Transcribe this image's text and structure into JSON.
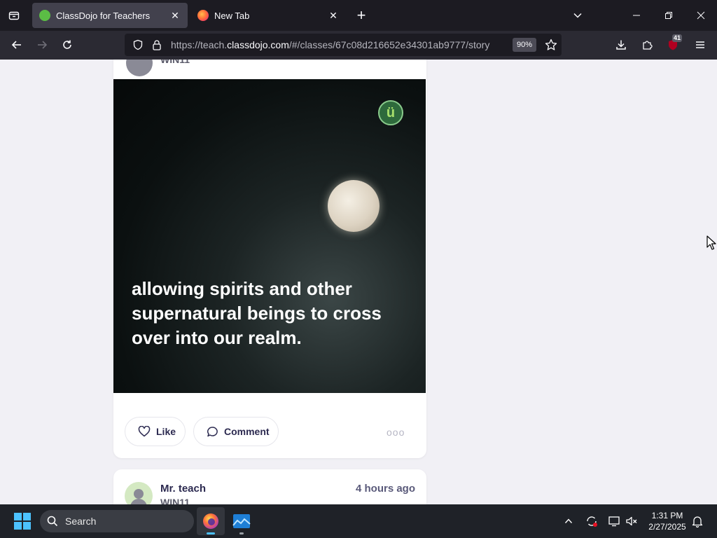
{
  "browser": {
    "tabs": [
      {
        "title": "ClassDojo for Teachers",
        "active": true
      },
      {
        "title": "New Tab",
        "active": false
      }
    ],
    "url_prefix": "https://teach.",
    "url_host": "classdojo.com",
    "url_path": "/#/classes/67c08d216652e34301ab9777/story",
    "zoom": "90%",
    "extension_badge": "41"
  },
  "feed": {
    "partial_post": {
      "class_name": "WIN11",
      "caption": "allowing spirits and other supernatural beings to cross over into our realm.",
      "like_label": "Like",
      "comment_label": "Comment",
      "more_label": "ooo",
      "badge_glyph": "ü"
    },
    "next_post": {
      "author": "Mr. teach",
      "class_name": "WIN11",
      "time": "4 hours ago"
    }
  },
  "taskbar": {
    "search_placeholder": "Search",
    "time": "1:31 PM",
    "date": "2/27/2025"
  },
  "colors": {
    "tab_bar": "#1c1b22",
    "nav_bar": "#2b2a33",
    "page_bg": "#f1f0f5",
    "text_primary": "#2c2a50",
    "taskbar": "#1f2228"
  }
}
